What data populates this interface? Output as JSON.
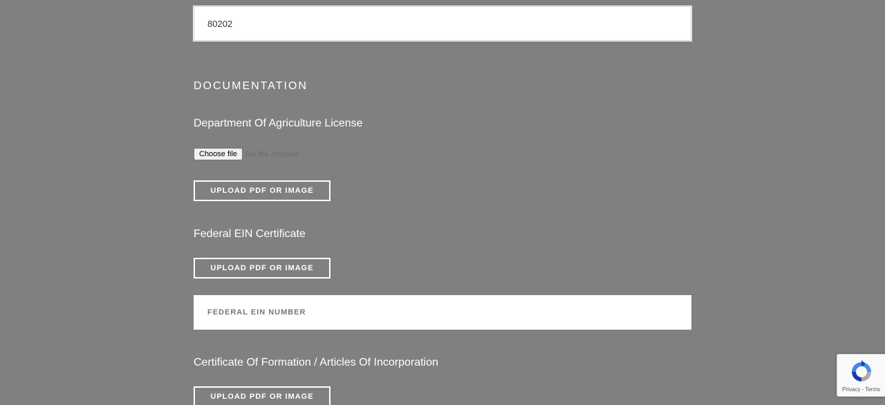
{
  "zip": {
    "value": "80202"
  },
  "documentation": {
    "heading": "DOCUMENTATION",
    "agriculture_license": {
      "label": "Department Of Agriculture License",
      "choose_file_label": "Choose file",
      "no_file_text": "No file chosen",
      "upload_label": "UPLOAD PDF OR IMAGE"
    },
    "ein_certificate": {
      "label": "Federal EIN Certificate",
      "upload_label": "UPLOAD PDF OR IMAGE",
      "ein_placeholder": "FEDERAL EIN NUMBER"
    },
    "formation_certificate": {
      "label": "Certificate Of Formation / Articles Of Incorporation",
      "upload_label": "UPLOAD PDF OR IMAGE"
    }
  },
  "recaptcha": {
    "privacy": "Privacy",
    "separator": " - ",
    "terms": "Terms",
    "icon": "recaptcha-logo-icon"
  },
  "colors": {
    "overlay_background": "#808080",
    "field_background": "#ffffff",
    "text": "#ffffff"
  }
}
